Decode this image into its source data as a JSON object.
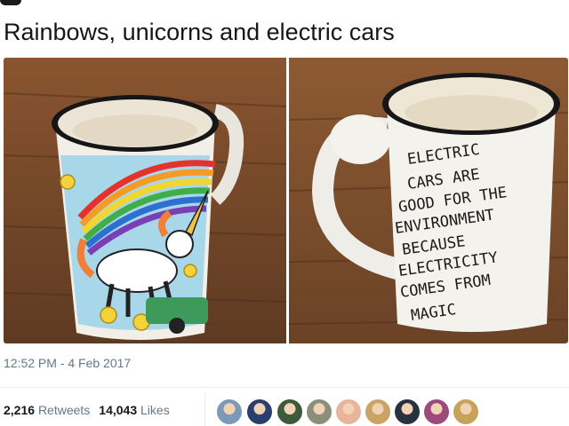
{
  "tweet": {
    "text": "Rainbows, unicorns and electric cars",
    "timestamp": "12:52 PM - 4 Feb 2017"
  },
  "media": {
    "left_photo": {
      "icon": "mug-unicorn-rainbow-image"
    },
    "right_photo": {
      "icon": "mug-handwritten-text-image",
      "mug_text_lines": [
        "ELECTRIC",
        "CARS ARE",
        "GOOD FOR THE",
        "ENVIRONMENT",
        "BECAUSE",
        "ELECTRICITY",
        "COMES FROM",
        "MAGIC"
      ]
    }
  },
  "stats": {
    "retweets_count": "2,216",
    "retweets_label": "Retweets",
    "likes_count": "14,043",
    "likes_label": "Likes"
  },
  "avatars": [
    {
      "icon": "user-avatar-1",
      "color": "#7a9ab8"
    },
    {
      "icon": "user-avatar-2",
      "color": "#2b3f6e"
    },
    {
      "icon": "user-avatar-3",
      "color": "#3d5a3a"
    },
    {
      "icon": "user-avatar-4",
      "color": "#8a8f7a"
    },
    {
      "icon": "user-avatar-5",
      "color": "#e8b49a"
    },
    {
      "icon": "user-avatar-6",
      "color": "#c9a466"
    },
    {
      "icon": "user-avatar-7",
      "color": "#27313f"
    },
    {
      "icon": "user-avatar-8",
      "color": "#9c4a7c"
    },
    {
      "icon": "user-avatar-9",
      "color": "#c7a35a"
    }
  ],
  "colors": {
    "text": "#14171a",
    "muted": "#657786",
    "link": "#1da1f2",
    "wood": "#7a4a2a"
  }
}
